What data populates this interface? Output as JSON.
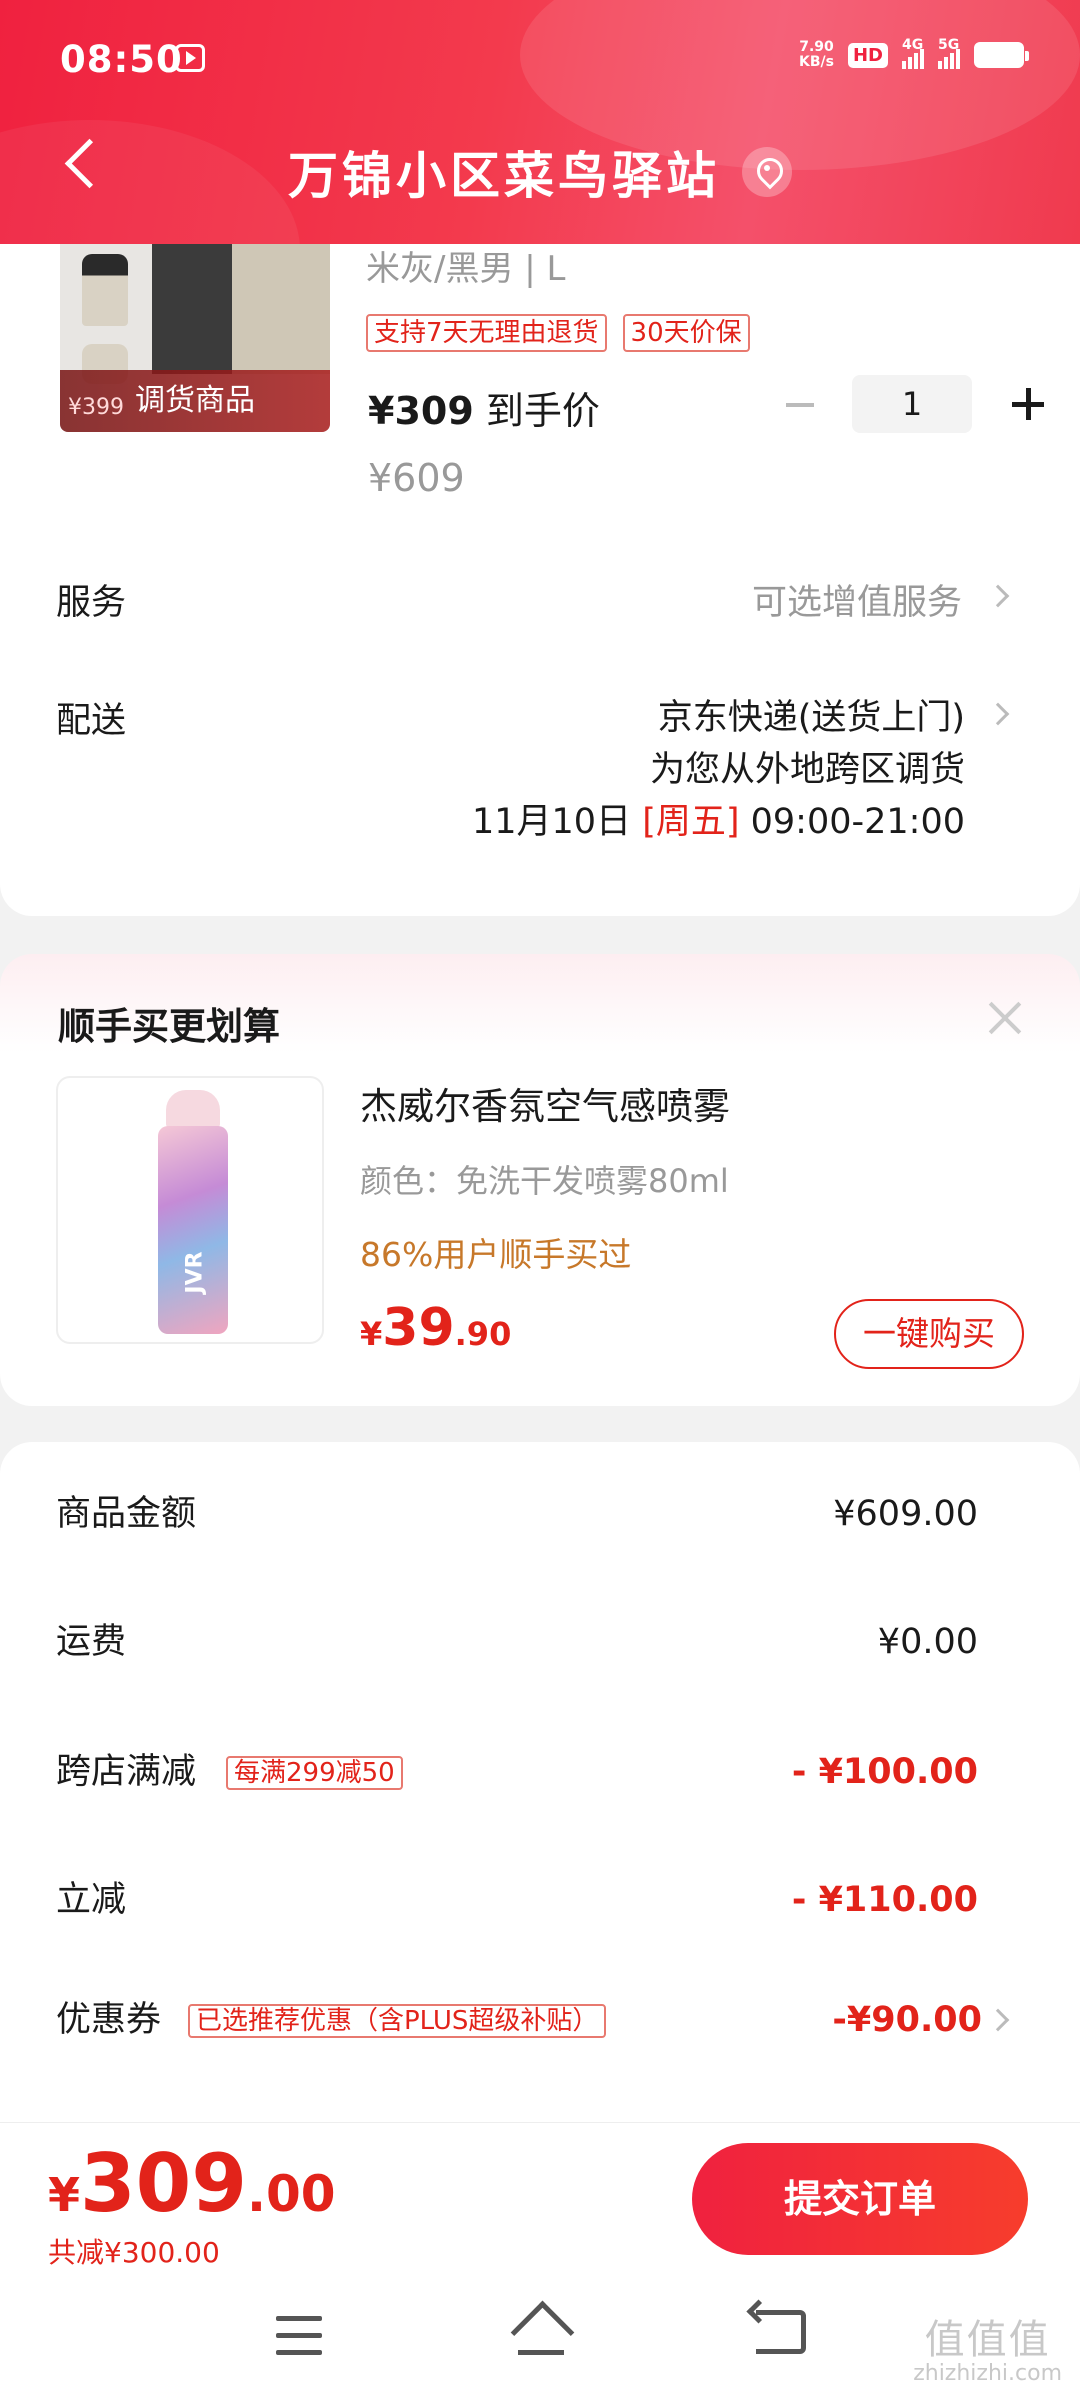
{
  "status_bar": {
    "time": "08:50",
    "net_speed_value": "7.90",
    "net_speed_unit": "KB/s",
    "hd": "HD",
    "sig1": "4G",
    "sig2": "5G"
  },
  "header": {
    "title": "万锦小区菜鸟驿站",
    "icons": [
      "back-icon",
      "location-icon"
    ]
  },
  "product": {
    "badge": "调货商品",
    "badge_price": "¥399",
    "spec": "米灰/黑男 | L",
    "tags": [
      "支持7天无理由退货",
      "30天价保"
    ],
    "price": "¥309",
    "price_suffix": " 到手价",
    "original_price": "¥609",
    "quantity": "1"
  },
  "service": {
    "label": "服务",
    "value": "可选增值服务"
  },
  "delivery": {
    "label": "配送",
    "line1": "京东快递(送货上门)",
    "line2": "为您从外地跨区调货",
    "date": "11月10日",
    "weekday": "[周五]",
    "time": "09:00-21:00"
  },
  "recommend": {
    "title": "顺手买更划算",
    "name": "杰威尔香氛空气感喷雾",
    "spec": "颜色：免洗干发喷雾80ml",
    "popular": "86%用户顺手买过",
    "price_sym": "¥",
    "price_int": "39",
    "price_dec": ".90",
    "buy_label": "一键购买",
    "brand": "JVR"
  },
  "amounts": {
    "goods_label": "商品金额",
    "goods_value": "¥609.00",
    "shipping_label": "运费",
    "shipping_value": "¥0.00",
    "cross_label": "跨店满减",
    "cross_tag": "每满299减50",
    "cross_value": "- ¥100.00",
    "instant_label": "立减",
    "instant_value": "- ¥110.00",
    "coupon_label": "优惠券",
    "coupon_tag": "已选推荐优惠（含PLUS超级补贴）",
    "coupon_value": "-¥90.00"
  },
  "footer": {
    "total_sym": "¥",
    "total_int": "309",
    "total_dec": ".00",
    "saved": "共减¥300.00",
    "submit": "提交订单"
  },
  "watermark": {
    "top": "值值值",
    "bottom": "zhizhizhi.com"
  },
  "colors": {
    "accent_red": "#e2231a",
    "header_red": "#f0213f",
    "popular_orange": "#c7782a"
  }
}
